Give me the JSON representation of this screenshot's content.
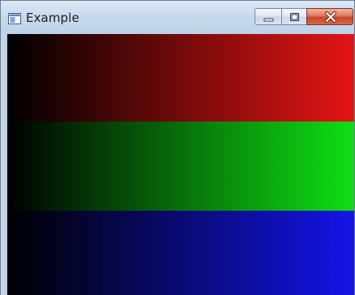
{
  "window": {
    "title": "Example"
  },
  "icons": {
    "app": "app-window-icon",
    "minimize": "minimize-icon",
    "maximize": "maximize-icon",
    "close": "close-icon"
  },
  "bands": [
    {
      "name": "red-gradient-band",
      "color": "#e51414"
    },
    {
      "name": "green-gradient-band",
      "color": "#0fdf14"
    },
    {
      "name": "blue-gradient-band",
      "color": "#1414e8"
    }
  ]
}
